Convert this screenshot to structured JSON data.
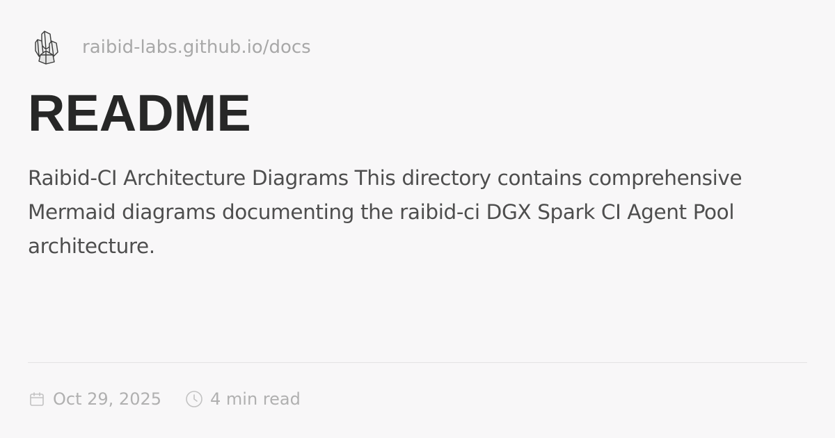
{
  "site": {
    "logo_icon": "crystal-cluster-icon",
    "url": "raibid-labs.github.io/docs"
  },
  "page": {
    "title": "README",
    "description": "Raibid-CI Architecture Diagrams This directory contains comprehensive Mermaid diagrams documenting the raibid-ci DGX Spark CI Agent Pool architecture."
  },
  "meta": {
    "date_icon": "calendar-icon",
    "date": "Oct 29, 2025",
    "read_time_icon": "clock-icon",
    "read_time": "4 min read"
  },
  "colors": {
    "background": "#f8f7f8",
    "title": "#272727",
    "body_text": "#4e4e4e",
    "muted_text": "#a8a8a8",
    "divider": "#e3e2e3"
  }
}
